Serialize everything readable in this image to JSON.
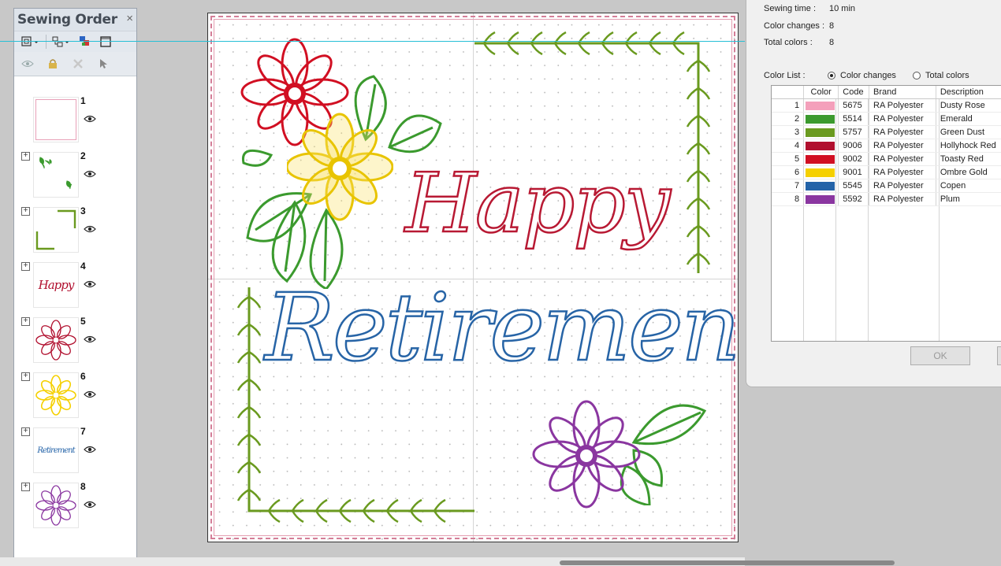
{
  "sewing_order": {
    "title": "Sewing Order",
    "close_glyph": "×",
    "items": [
      {
        "number": "1",
        "expandable": false,
        "thumb": "frame"
      },
      {
        "number": "2",
        "expandable": true,
        "thumb": "leaves"
      },
      {
        "number": "3",
        "expandable": true,
        "thumb": "border"
      },
      {
        "number": "4",
        "expandable": true,
        "thumb": "happy",
        "thumb_text": "Happy"
      },
      {
        "number": "5",
        "expandable": true,
        "thumb": "red-flower"
      },
      {
        "number": "6",
        "expandable": true,
        "thumb": "yellow-flower"
      },
      {
        "number": "7",
        "expandable": true,
        "thumb": "retirement",
        "thumb_text": "Retirement"
      },
      {
        "number": "8",
        "expandable": true,
        "thumb": "purple-flower"
      }
    ]
  },
  "design": {
    "line1": "Happy",
    "line2": "Retirement"
  },
  "stats": {
    "sewing_time_label": "Sewing time :",
    "sewing_time_value": "10 min",
    "color_changes_label": "Color changes :",
    "color_changes_value": "8",
    "total_colors_label": "Total colors :",
    "total_colors_value": "8"
  },
  "color_list": {
    "label": "Color List :",
    "option_changes": "Color changes",
    "option_total": "Total colors",
    "selected": "Color changes",
    "headers": {
      "color": "Color",
      "code": "Code",
      "brand": "Brand",
      "description": "Description"
    },
    "rows": [
      {
        "index": "1",
        "hex": "#f4a0bb",
        "code": "5675",
        "brand": "RA Polyester",
        "description": "Dusty Rose"
      },
      {
        "index": "2",
        "hex": "#3b9a2e",
        "code": "5514",
        "brand": "RA Polyester",
        "description": "Emerald"
      },
      {
        "index": "3",
        "hex": "#6a9a1f",
        "code": "5757",
        "brand": "RA Polyester",
        "description": "Green Dust"
      },
      {
        "index": "4",
        "hex": "#b10f2e",
        "code": "9006",
        "brand": "RA Polyester",
        "description": "Hollyhock Red"
      },
      {
        "index": "5",
        "hex": "#d10f22",
        "code": "9002",
        "brand": "RA Polyester",
        "description": "Toasty Red"
      },
      {
        "index": "6",
        "hex": "#f5d000",
        "code": "9001",
        "brand": "RA Polyester",
        "description": "Ombre Gold"
      },
      {
        "index": "7",
        "hex": "#2463a8",
        "code": "5545",
        "brand": "RA Polyester",
        "description": "Copen"
      },
      {
        "index": "8",
        "hex": "#8a36a0",
        "code": "5592",
        "brand": "RA Polyester",
        "description": "Plum"
      }
    ]
  },
  "buttons": {
    "ok": "OK"
  }
}
